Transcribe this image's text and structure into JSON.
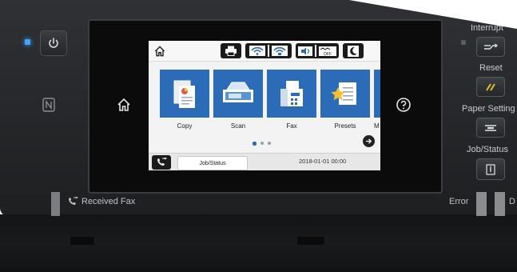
{
  "left_panel": {
    "received_fax_label": "Received Fax",
    "icons": [
      "power-icon",
      "nfc-icon"
    ]
  },
  "bezel": {
    "left_icon": "home-icon",
    "right_icon": "help-icon"
  },
  "screen": {
    "status_icons": [
      "home-icon",
      "printer-icon",
      "wifi-icon",
      "wifi-direct-icon",
      "sound-icon",
      "quiet-off-icon",
      "sleep-icon"
    ],
    "tiles": [
      {
        "label": "Copy"
      },
      {
        "label": "Scan"
      },
      {
        "label": "Fax"
      },
      {
        "label": "Presets"
      },
      {
        "label": "M"
      }
    ],
    "page_indicator": {
      "pages": 3,
      "current": 1
    },
    "bottom_bar": {
      "job_status_label": "Job/Status",
      "datetime": "2018-01-01 00:00"
    }
  },
  "right_panel": {
    "interrupt_label": "Interrupt",
    "reset_label": "Reset",
    "paper_setting_label": "Paper Setting",
    "job_status_label": "Job/Status",
    "error_label": "Error",
    "data_label": "D"
  },
  "colors": {
    "accent_blue": "#2c6bb7",
    "reset_yellow": "#e8c21a",
    "power_led": "#3fa3ff"
  }
}
